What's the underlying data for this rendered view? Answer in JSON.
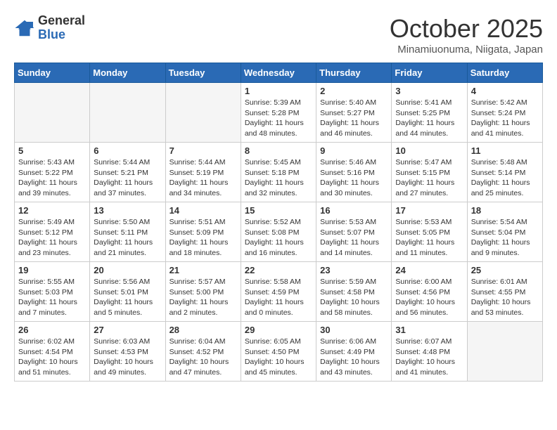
{
  "logo": {
    "general": "General",
    "blue": "Blue"
  },
  "title": "October 2025",
  "location": "Minamiuonuma, Niigata, Japan",
  "days_of_week": [
    "Sunday",
    "Monday",
    "Tuesday",
    "Wednesday",
    "Thursday",
    "Friday",
    "Saturday"
  ],
  "weeks": [
    [
      {
        "day": null,
        "sunrise": null,
        "sunset": null,
        "daylight": null
      },
      {
        "day": null,
        "sunrise": null,
        "sunset": null,
        "daylight": null
      },
      {
        "day": null,
        "sunrise": null,
        "sunset": null,
        "daylight": null
      },
      {
        "day": "1",
        "sunrise": "Sunrise: 5:39 AM",
        "sunset": "Sunset: 5:28 PM",
        "daylight": "Daylight: 11 hours and 48 minutes."
      },
      {
        "day": "2",
        "sunrise": "Sunrise: 5:40 AM",
        "sunset": "Sunset: 5:27 PM",
        "daylight": "Daylight: 11 hours and 46 minutes."
      },
      {
        "day": "3",
        "sunrise": "Sunrise: 5:41 AM",
        "sunset": "Sunset: 5:25 PM",
        "daylight": "Daylight: 11 hours and 44 minutes."
      },
      {
        "day": "4",
        "sunrise": "Sunrise: 5:42 AM",
        "sunset": "Sunset: 5:24 PM",
        "daylight": "Daylight: 11 hours and 41 minutes."
      }
    ],
    [
      {
        "day": "5",
        "sunrise": "Sunrise: 5:43 AM",
        "sunset": "Sunset: 5:22 PM",
        "daylight": "Daylight: 11 hours and 39 minutes."
      },
      {
        "day": "6",
        "sunrise": "Sunrise: 5:44 AM",
        "sunset": "Sunset: 5:21 PM",
        "daylight": "Daylight: 11 hours and 37 minutes."
      },
      {
        "day": "7",
        "sunrise": "Sunrise: 5:44 AM",
        "sunset": "Sunset: 5:19 PM",
        "daylight": "Daylight: 11 hours and 34 minutes."
      },
      {
        "day": "8",
        "sunrise": "Sunrise: 5:45 AM",
        "sunset": "Sunset: 5:18 PM",
        "daylight": "Daylight: 11 hours and 32 minutes."
      },
      {
        "day": "9",
        "sunrise": "Sunrise: 5:46 AM",
        "sunset": "Sunset: 5:16 PM",
        "daylight": "Daylight: 11 hours and 30 minutes."
      },
      {
        "day": "10",
        "sunrise": "Sunrise: 5:47 AM",
        "sunset": "Sunset: 5:15 PM",
        "daylight": "Daylight: 11 hours and 27 minutes."
      },
      {
        "day": "11",
        "sunrise": "Sunrise: 5:48 AM",
        "sunset": "Sunset: 5:14 PM",
        "daylight": "Daylight: 11 hours and 25 minutes."
      }
    ],
    [
      {
        "day": "12",
        "sunrise": "Sunrise: 5:49 AM",
        "sunset": "Sunset: 5:12 PM",
        "daylight": "Daylight: 11 hours and 23 minutes."
      },
      {
        "day": "13",
        "sunrise": "Sunrise: 5:50 AM",
        "sunset": "Sunset: 5:11 PM",
        "daylight": "Daylight: 11 hours and 21 minutes."
      },
      {
        "day": "14",
        "sunrise": "Sunrise: 5:51 AM",
        "sunset": "Sunset: 5:09 PM",
        "daylight": "Daylight: 11 hours and 18 minutes."
      },
      {
        "day": "15",
        "sunrise": "Sunrise: 5:52 AM",
        "sunset": "Sunset: 5:08 PM",
        "daylight": "Daylight: 11 hours and 16 minutes."
      },
      {
        "day": "16",
        "sunrise": "Sunrise: 5:53 AM",
        "sunset": "Sunset: 5:07 PM",
        "daylight": "Daylight: 11 hours and 14 minutes."
      },
      {
        "day": "17",
        "sunrise": "Sunrise: 5:53 AM",
        "sunset": "Sunset: 5:05 PM",
        "daylight": "Daylight: 11 hours and 11 minutes."
      },
      {
        "day": "18",
        "sunrise": "Sunrise: 5:54 AM",
        "sunset": "Sunset: 5:04 PM",
        "daylight": "Daylight: 11 hours and 9 minutes."
      }
    ],
    [
      {
        "day": "19",
        "sunrise": "Sunrise: 5:55 AM",
        "sunset": "Sunset: 5:03 PM",
        "daylight": "Daylight: 11 hours and 7 minutes."
      },
      {
        "day": "20",
        "sunrise": "Sunrise: 5:56 AM",
        "sunset": "Sunset: 5:01 PM",
        "daylight": "Daylight: 11 hours and 5 minutes."
      },
      {
        "day": "21",
        "sunrise": "Sunrise: 5:57 AM",
        "sunset": "Sunset: 5:00 PM",
        "daylight": "Daylight: 11 hours and 2 minutes."
      },
      {
        "day": "22",
        "sunrise": "Sunrise: 5:58 AM",
        "sunset": "Sunset: 4:59 PM",
        "daylight": "Daylight: 11 hours and 0 minutes."
      },
      {
        "day": "23",
        "sunrise": "Sunrise: 5:59 AM",
        "sunset": "Sunset: 4:58 PM",
        "daylight": "Daylight: 10 hours and 58 minutes."
      },
      {
        "day": "24",
        "sunrise": "Sunrise: 6:00 AM",
        "sunset": "Sunset: 4:56 PM",
        "daylight": "Daylight: 10 hours and 56 minutes."
      },
      {
        "day": "25",
        "sunrise": "Sunrise: 6:01 AM",
        "sunset": "Sunset: 4:55 PM",
        "daylight": "Daylight: 10 hours and 53 minutes."
      }
    ],
    [
      {
        "day": "26",
        "sunrise": "Sunrise: 6:02 AM",
        "sunset": "Sunset: 4:54 PM",
        "daylight": "Daylight: 10 hours and 51 minutes."
      },
      {
        "day": "27",
        "sunrise": "Sunrise: 6:03 AM",
        "sunset": "Sunset: 4:53 PM",
        "daylight": "Daylight: 10 hours and 49 minutes."
      },
      {
        "day": "28",
        "sunrise": "Sunrise: 6:04 AM",
        "sunset": "Sunset: 4:52 PM",
        "daylight": "Daylight: 10 hours and 47 minutes."
      },
      {
        "day": "29",
        "sunrise": "Sunrise: 6:05 AM",
        "sunset": "Sunset: 4:50 PM",
        "daylight": "Daylight: 10 hours and 45 minutes."
      },
      {
        "day": "30",
        "sunrise": "Sunrise: 6:06 AM",
        "sunset": "Sunset: 4:49 PM",
        "daylight": "Daylight: 10 hours and 43 minutes."
      },
      {
        "day": "31",
        "sunrise": "Sunrise: 6:07 AM",
        "sunset": "Sunset: 4:48 PM",
        "daylight": "Daylight: 10 hours and 41 minutes."
      },
      {
        "day": null,
        "sunrise": null,
        "sunset": null,
        "daylight": null
      }
    ]
  ]
}
